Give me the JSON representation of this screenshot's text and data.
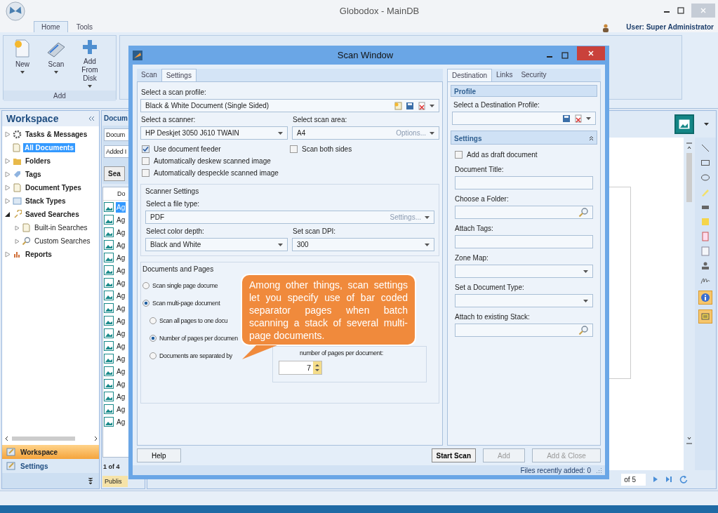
{
  "app": {
    "title": "Globodox - MainDB",
    "user": "User: Super Administrator"
  },
  "ribbon_tabs": [
    {
      "label": "Home",
      "selected": true
    },
    {
      "label": "Tools",
      "selected": false
    }
  ],
  "ribbon_group": {
    "label": "Add",
    "buttons": [
      {
        "label": "New",
        "dropdown": true
      },
      {
        "label": "Scan",
        "dropdown": true
      },
      {
        "label": "Add From Disk",
        "dropdown": true
      }
    ]
  },
  "workspace": {
    "title": "Workspace",
    "items": [
      {
        "label": "Tasks & Messages",
        "expanded": false,
        "selected": false
      },
      {
        "label": "All Documents",
        "selected": true
      },
      {
        "label": "Folders",
        "expanded": false,
        "selected": false
      },
      {
        "label": "Tags",
        "expanded": false,
        "selected": false
      },
      {
        "label": "Document Types",
        "expanded": false,
        "selected": false
      },
      {
        "label": "Stack Types",
        "expanded": false,
        "selected": false
      },
      {
        "label": "Saved Searches",
        "expanded": true,
        "selected": false,
        "children": [
          {
            "label": "Built-in Searches",
            "expanded": false,
            "selected": false
          },
          {
            "label": "Custom Searches",
            "expanded": false,
            "selected": false
          }
        ]
      },
      {
        "label": "Reports",
        "expanded": false,
        "selected": false
      }
    ],
    "nav": [
      {
        "label": "Workspace",
        "selected": true
      },
      {
        "label": "Settings",
        "selected": false
      }
    ]
  },
  "document_list": {
    "title": "Docum",
    "filters": [
      "Docum",
      "Added I"
    ],
    "search_button": "Sea",
    "column": "Do",
    "rows": [
      {
        "name": "Ag",
        "selected": true
      },
      {
        "name": "Ag",
        "selected": false
      },
      {
        "name": "Ag",
        "selected": false
      },
      {
        "name": "Ag",
        "selected": false
      },
      {
        "name": "Ag",
        "selected": false
      },
      {
        "name": "Ag",
        "selected": false
      },
      {
        "name": "Ag",
        "selected": false
      },
      {
        "name": "Ag",
        "selected": false
      },
      {
        "name": "Ag",
        "selected": false
      },
      {
        "name": "Ag",
        "selected": false
      },
      {
        "name": "Ag",
        "selected": false
      },
      {
        "name": "Ag",
        "selected": false
      },
      {
        "name": "Ag",
        "selected": false
      },
      {
        "name": "Ag",
        "selected": false
      },
      {
        "name": "Ag",
        "selected": false
      },
      {
        "name": "Ag",
        "selected": false
      },
      {
        "name": "Ag",
        "selected": false
      },
      {
        "name": "Ag",
        "selected": false
      }
    ],
    "pager": "1 of 4",
    "status_tab": "Publis"
  },
  "viewer": {
    "page": "of 5"
  },
  "scan_window": {
    "title": "Scan Window",
    "left_tabs": [
      {
        "label": "Scan",
        "selected": false
      },
      {
        "label": "Settings",
        "selected": true
      }
    ],
    "profile_label": "Select a scan profile:",
    "profile": "Black & White Document (Single Sided)",
    "scanner_label": "Select a scanner:",
    "scanner": "HP Deskjet 3050 J610 TWAIN",
    "area_label": "Select scan area:",
    "area": "A4",
    "area_options": "Options...",
    "checks": [
      {
        "label": "Use document feeder",
        "checked": true
      },
      {
        "label": "Scan both sides",
        "checked": false
      },
      {
        "label": "Automatically deskew scanned image",
        "checked": false
      },
      {
        "label": "Automatically despeckle scanned image",
        "checked": false
      }
    ],
    "scanner_settings": {
      "title": "Scanner Settings",
      "file_type_label": "Select a file type:",
      "file_type": "PDF",
      "file_settings": "Settings...",
      "color_label": "Select color depth:",
      "color_depth": "Black and White",
      "dpi_label": "Set scan DPI:",
      "dpi": "300"
    },
    "documents_pages": {
      "title": "Documents and Pages",
      "options": [
        {
          "label": "Scan single page docume",
          "selected": false
        },
        {
          "label": "Scan multi-page document",
          "selected": true,
          "children": [
            {
              "label": "Scan all pages to one docu",
              "selected": false
            },
            {
              "label": "Number of pages per documen",
              "selected": true
            },
            {
              "label": "Documents are separated by",
              "selected": false
            }
          ]
        }
      ],
      "pages_label": "number of pages per document:",
      "pages_value": "7"
    },
    "right_tabs": [
      {
        "label": "Destination",
        "selected": true
      },
      {
        "label": "Links",
        "selected": false
      },
      {
        "label": "Security",
        "selected": false
      }
    ],
    "profile_header": "Profile",
    "destination_label": "Select a Destination Profile:",
    "settings_header": "Settings",
    "draft": {
      "label": "Add as draft document",
      "checked": false
    },
    "fields": [
      {
        "label": "Document Title:",
        "kind": "text"
      },
      {
        "label": "Choose a Folder:",
        "kind": "search"
      },
      {
        "label": "Attach Tags:",
        "kind": "text"
      },
      {
        "label": "Zone Map:",
        "kind": "select"
      },
      {
        "label": "Set a Document Type:",
        "kind": "select"
      },
      {
        "label": "Attach to existing Stack:",
        "kind": "search"
      }
    ],
    "help_button": "Help",
    "buttons": [
      {
        "label": "Start Scan",
        "disabled": false
      },
      {
        "label": "Add",
        "disabled": true
      },
      {
        "label": "Add & Close",
        "disabled": true
      }
    ],
    "status": "Files recently added: 0"
  },
  "callout": {
    "text": "Among other things, scan settings let you specify use of bar coded separator pages when batch scanning a stack of several multi-page documents."
  }
}
